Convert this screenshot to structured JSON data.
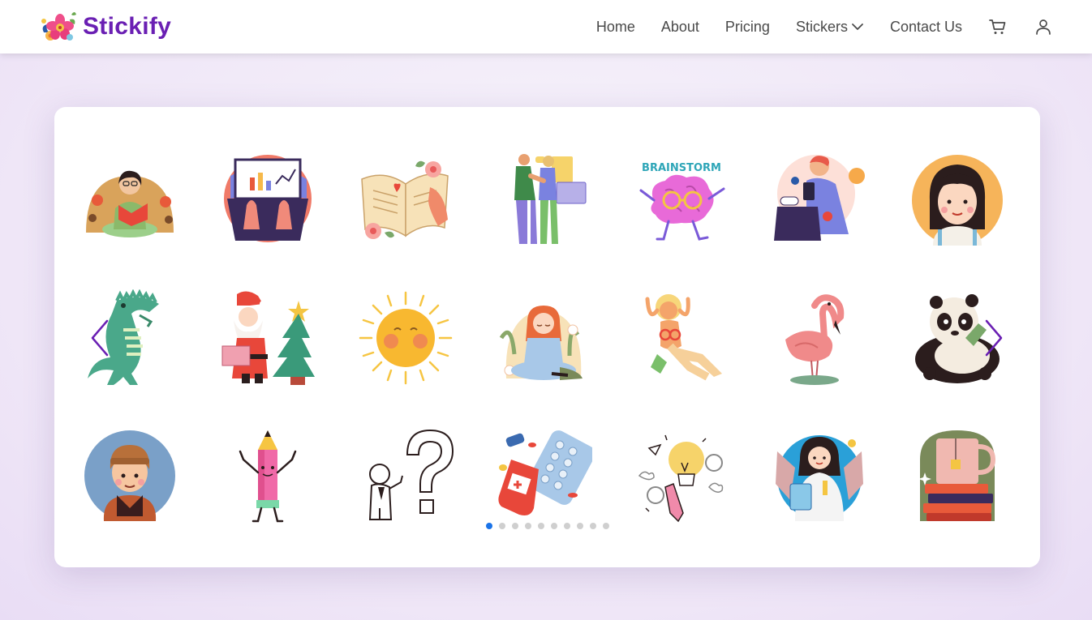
{
  "brand": {
    "name": "Stickify",
    "logo_icon": "flower-logo-icon"
  },
  "nav": {
    "links": [
      "Home",
      "About",
      "Pricing",
      "Stickers",
      "Contact Us"
    ],
    "cart_icon": "cart-icon",
    "user_icon": "user-icon"
  },
  "colors": {
    "brand": "#6a1fb3",
    "arrow": "#6a1fb3",
    "active_dot": "#1a73e8"
  },
  "carousel": {
    "prev_icon": "chevron-left-icon",
    "next_icon": "chevron-right-icon",
    "active_page": 1,
    "page_count": 10,
    "stickers": [
      "reading-girl-sticker",
      "laptop-hands-sticker",
      "open-book-flowers-sticker",
      "handshake-business-sticker",
      "brainstorm-brain-sticker",
      "phone-laptop-man-sticker",
      "girl-avatar-sticker",
      "crocodile-sticker",
      "santa-tree-sticker",
      "sun-sticker",
      "meditating-girl-sticker",
      "relaxing-woman-sticker",
      "flamingo-sticker",
      "panda-sticker",
      "boy-avatar-sticker",
      "pencil-character-sticker",
      "question-mark-sticker",
      "medicine-pills-sticker",
      "lightbulb-idea-sticker",
      "scientist-woman-sticker",
      "books-mug-sticker"
    ],
    "brainstorm_text": "BRAINSTORM"
  }
}
